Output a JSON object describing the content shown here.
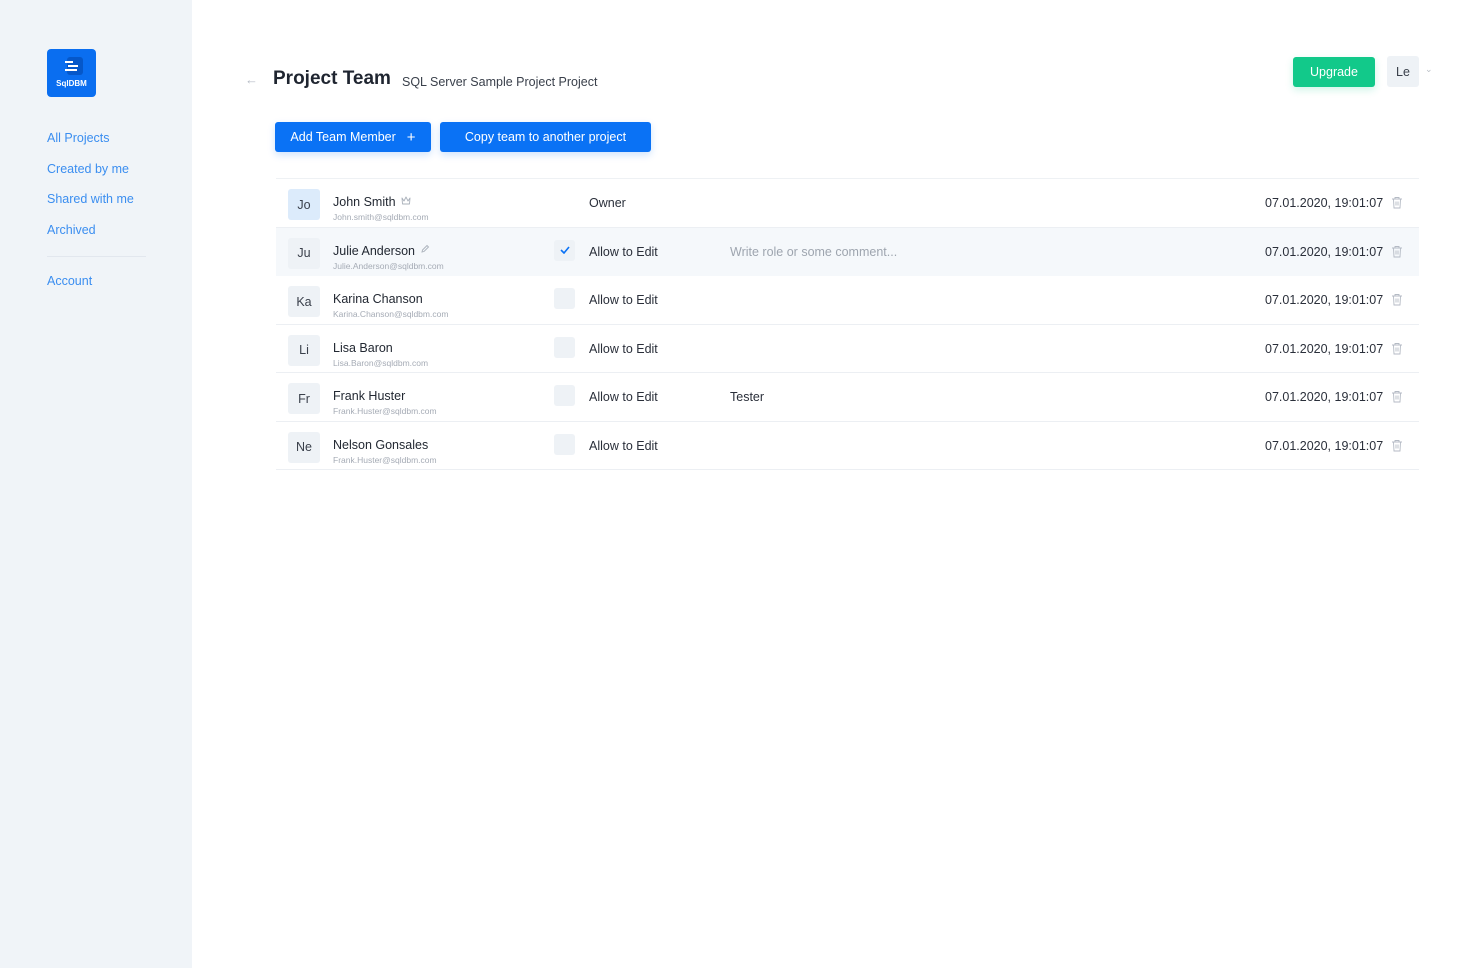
{
  "app": {
    "logo_text": "SqlDBM"
  },
  "sidebar": {
    "items": [
      {
        "label": "All Projects"
      },
      {
        "label": "Created by me"
      },
      {
        "label": "Shared with me"
      },
      {
        "label": "Archived"
      }
    ],
    "account_label": "Account"
  },
  "header": {
    "back_icon": "arrow-left-icon",
    "title": "Project Team",
    "subtitle": "SQL Server Sample Project Project",
    "upgrade_label": "Upgrade",
    "user_initials": "Le"
  },
  "toolbar": {
    "add_member_label": "Add Team Member",
    "add_member_icon": "+",
    "copy_team_label": "Copy team to another project"
  },
  "colors": {
    "primary": "#0a72f5",
    "upgrade": "#12c98a",
    "sidebar_bg": "#f0f4f8",
    "link": "#3b8ef0"
  },
  "members": [
    {
      "initials": "Jo",
      "name": "John Smith",
      "name_icon": "crown-icon",
      "email": "John.smith@sqldbm.com",
      "checkbox": null,
      "permission": "Owner",
      "comment": "",
      "comment_placeholder": "",
      "date": "07.01.2020, 19:01:07"
    },
    {
      "initials": "Ju",
      "name": "Julie Anderson",
      "name_icon": "pencil-icon",
      "email": "Julie.Anderson@sqldbm.com",
      "checkbox": true,
      "permission": "Allow to Edit",
      "comment": "",
      "comment_placeholder": "Write role or some comment...",
      "date": "07.01.2020, 19:01:07"
    },
    {
      "initials": "Ka",
      "name": "Karina Chanson",
      "name_icon": null,
      "email": "Karina.Chanson@sqldbm.com",
      "checkbox": false,
      "permission": "Allow to Edit",
      "comment": "",
      "comment_placeholder": "",
      "date": "07.01.2020, 19:01:07"
    },
    {
      "initials": "Li",
      "name": "Lisa Baron",
      "name_icon": null,
      "email": "Lisa.Baron@sqldbm.com",
      "checkbox": false,
      "permission": "Allow to Edit",
      "comment": "",
      "comment_placeholder": "",
      "date": "07.01.2020, 19:01:07"
    },
    {
      "initials": "Fr",
      "name": "Frank Huster",
      "name_icon": null,
      "email": "Frank.Huster@sqldbm.com",
      "checkbox": false,
      "permission": "Allow to Edit",
      "comment": "Tester",
      "comment_placeholder": "",
      "date": "07.01.2020, 19:01:07"
    },
    {
      "initials": "Ne",
      "name": "Nelson Gonsales",
      "name_icon": null,
      "email": "Frank.Huster@sqldbm.com",
      "checkbox": false,
      "permission": "Allow to Edit",
      "comment": "",
      "comment_placeholder": "",
      "date": "07.01.2020, 19:01:07"
    }
  ]
}
